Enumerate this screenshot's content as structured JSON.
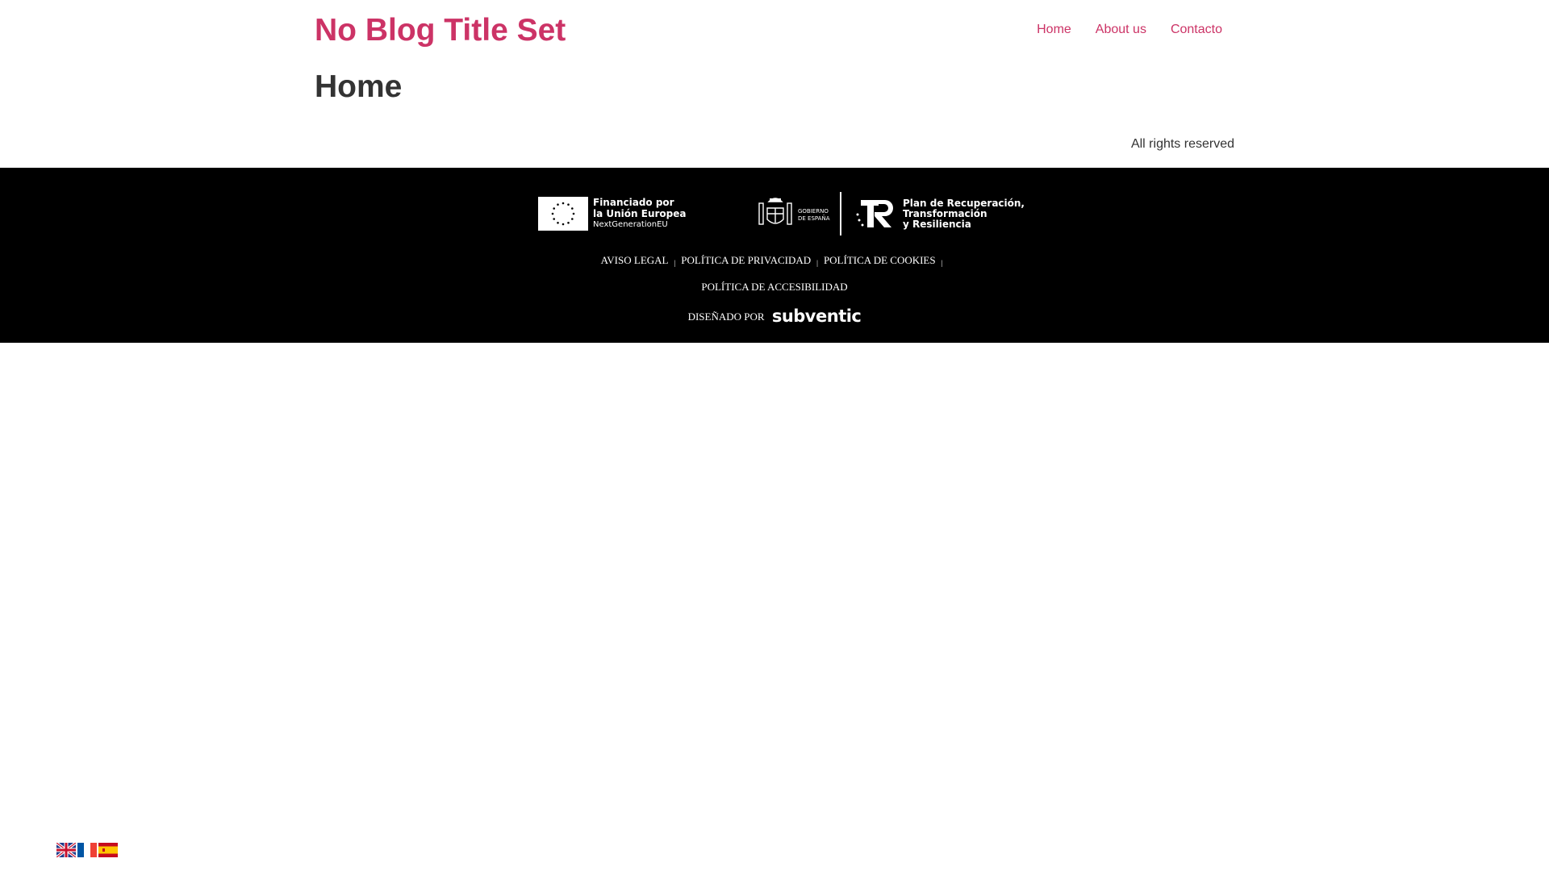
{
  "header": {
    "site_title": "No Blog Title Set",
    "nav": [
      {
        "label": "Home"
      },
      {
        "label": "About us"
      },
      {
        "label": "Contacto"
      }
    ]
  },
  "main": {
    "page_title": "Home",
    "rights": "All rights reserved"
  },
  "footer": {
    "eu_logo": {
      "line1": "Financiado por",
      "line2": "la Unión Europea",
      "line3": "NextGenerationEU"
    },
    "gov_logo": {
      "line1": "GOBIERNO",
      "line2": "DE ESPAÑA"
    },
    "prtr_logo": {
      "line1": "Plan de Recuperación,",
      "line2": "Transformación",
      "line3": "y Resiliencia"
    },
    "links": [
      {
        "label": "AVISO LEGAL"
      },
      {
        "label": "POLÍTICA DE PRIVACIDAD"
      },
      {
        "label": "POLÍTICA DE COOKIES"
      },
      {
        "label": "POLÍTICA DE ACCESIBILIDAD"
      }
    ],
    "designed_by": "DISEÑADO POR",
    "brand": "subventic"
  },
  "languages": [
    {
      "name": "english-flag-icon"
    },
    {
      "name": "french-flag-icon"
    },
    {
      "name": "spanish-flag-icon"
    }
  ],
  "colors": {
    "accent": "#cc3366",
    "text": "#333333",
    "footer_bg": "#000000"
  }
}
